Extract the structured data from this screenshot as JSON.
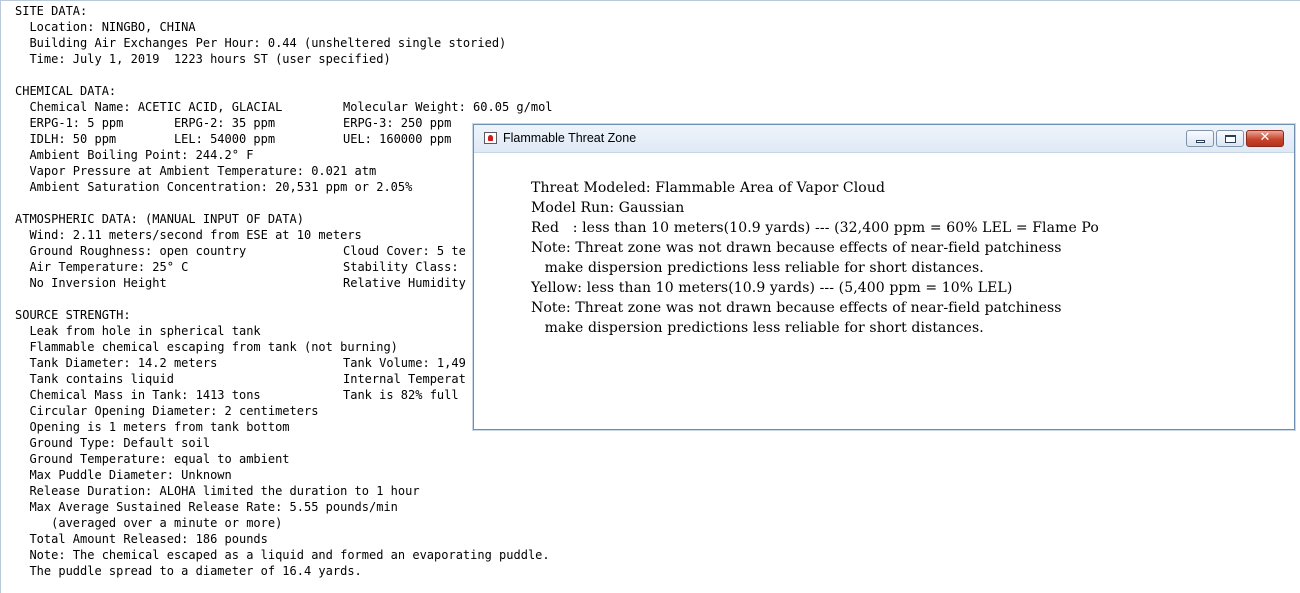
{
  "report": {
    "lines": [
      {
        "a": "SITE DATA:"
      },
      {
        "a": "  Location: NINGBO, CHINA"
      },
      {
        "a": "  Building Air Exchanges Per Hour: 0.44 (unsheltered single storied)"
      },
      {
        "a": "  Time: July 1, 2019  1223 hours ST (user specified)"
      },
      {
        "a": ""
      },
      {
        "a": "CHEMICAL DATA:"
      },
      {
        "a": "  Chemical Name: ACETIC ACID, GLACIAL",
        "b": "Molecular Weight: 60.05 g/mol"
      },
      {
        "a": "  ERPG-1: 5 ppm       ERPG-2: 35 ppm",
        "b": "ERPG-3: 250 ppm"
      },
      {
        "a": "  IDLH: 50 ppm        LEL: 54000 ppm",
        "b": "UEL: 160000 ppm"
      },
      {
        "a": "  Ambient Boiling Point: 244.2° F"
      },
      {
        "a": "  Vapor Pressure at Ambient Temperature: 0.021 atm"
      },
      {
        "a": "  Ambient Saturation Concentration: 20,531 ppm or 2.05%"
      },
      {
        "a": ""
      },
      {
        "a": "ATMOSPHERIC DATA: (MANUAL INPUT OF DATA)"
      },
      {
        "a": "  Wind: 2.11 meters/second from ESE at 10 meters"
      },
      {
        "a": "  Ground Roughness: open country",
        "b": "Cloud Cover: 5 te"
      },
      {
        "a": "  Air Temperature: 25° C",
        "b": "Stability Class:"
      },
      {
        "a": "  No Inversion Height",
        "b": "Relative Humidity"
      },
      {
        "a": ""
      },
      {
        "a": "SOURCE STRENGTH:"
      },
      {
        "a": "  Leak from hole in spherical tank"
      },
      {
        "a": "  Flammable chemical escaping from tank (not burning)"
      },
      {
        "a": "  Tank Diameter: 14.2 meters",
        "b": "Tank Volume: 1,49"
      },
      {
        "a": "  Tank contains liquid",
        "b": "Internal Temperat"
      },
      {
        "a": "  Chemical Mass in Tank: 1413 tons",
        "b": "Tank is 82% full"
      },
      {
        "a": "  Circular Opening Diameter: 2 centimeters"
      },
      {
        "a": "  Opening is 1 meters from tank bottom"
      },
      {
        "a": "  Ground Type: Default soil"
      },
      {
        "a": "  Ground Temperature: equal to ambient"
      },
      {
        "a": "  Max Puddle Diameter: Unknown"
      },
      {
        "a": "  Release Duration: ALOHA limited the duration to 1 hour"
      },
      {
        "a": "  Max Average Sustained Release Rate: 5.55 pounds/min"
      },
      {
        "a": "     (averaged over a minute or more)"
      },
      {
        "a": "  Total Amount Released: 186 pounds"
      },
      {
        "a": "  Note: The chemical escaped as a liquid and formed an evaporating puddle."
      },
      {
        "a": "  The puddle spread to a diameter of 16.4 yards."
      }
    ]
  },
  "threat_window": {
    "title": "Flammable Threat Zone",
    "icon": "aloha-app-icon",
    "buttons": {
      "minimize": "minimize-icon",
      "maximize": "maximize-icon",
      "close": "close-icon",
      "close_glyph": "✕"
    },
    "lines": [
      "",
      "Threat Modeled: Flammable Area of Vapor Cloud",
      "Model Run: Gaussian",
      "Red   : less than 10 meters(10.9 yards) --- (32,400 ppm = 60% LEL = Flame Po",
      "Note: Threat zone was not drawn because effects of near-field patchiness",
      "   make dispersion predictions less reliable for short distances.",
      "Yellow: less than 10 meters(10.9 yards) --- (5,400 ppm = 10% LEL)",
      "Note: Threat zone was not drawn because effects of near-field patchiness",
      "   make dispersion predictions less reliable for short distances."
    ]
  }
}
